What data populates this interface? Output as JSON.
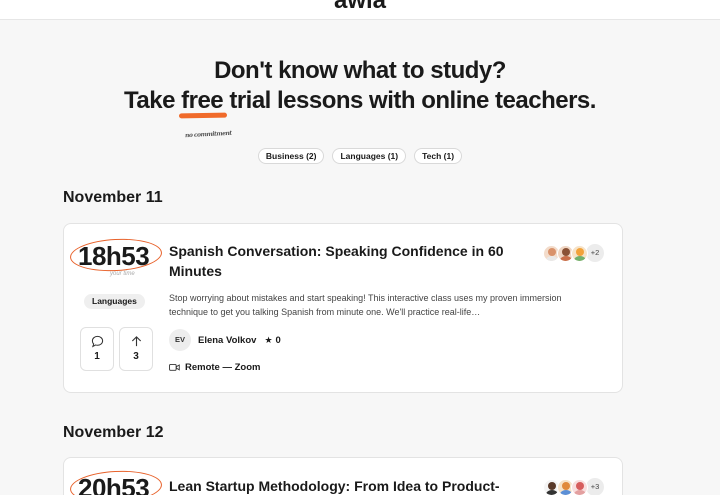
{
  "header": {
    "logo_text": "awia"
  },
  "hero": {
    "line1": "Don't know what to study?",
    "line2_before": "Take ",
    "line2_highlight": "free",
    "line2_after": " trial lessons with online teachers.",
    "scribble": "no commitment"
  },
  "filters": [
    {
      "label": "Business (2)"
    },
    {
      "label": "Languages (1)"
    },
    {
      "label": "Tech (1)"
    }
  ],
  "sections": [
    {
      "date": "November 11",
      "card": {
        "time": "18h53",
        "time_sub": "your time",
        "category": "Languages",
        "comments": "1",
        "upvotes": "3",
        "title": "Spanish Conversation: Speaking Confidence in 60 Minutes",
        "description": "Stop worrying about mistakes and start speaking! This interactive class uses my proven immersion technique to get you talking Spanish from minute one. We'll practice real-life…",
        "teacher_initials": "EV",
        "teacher_name": "Elena Volkov",
        "rating": "0",
        "location": "Remote — Zoom",
        "attendees_more": "+2"
      }
    },
    {
      "date": "November 12",
      "card": {
        "time": "20h53",
        "title": "Lean Startup Methodology: From Idea to Product-",
        "attendees_more": "+3"
      }
    }
  ],
  "colors": {
    "accent": "#f06a2a",
    "background": "#f7f7f7",
    "card": "#ffffff"
  },
  "icons": {
    "comment": "speech-bubble-icon",
    "upvote": "arrow-up-icon",
    "location": "video-camera-icon",
    "rating": "star-icon"
  }
}
